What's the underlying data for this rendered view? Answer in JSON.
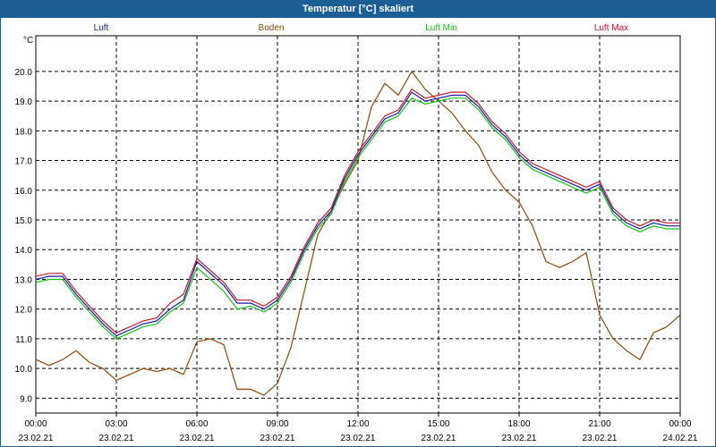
{
  "window": {
    "title": "Temperatur [°C] skaliert"
  },
  "chart_data": {
    "type": "line",
    "ylabel": "°C",
    "ylim": [
      8.5,
      21.2
    ],
    "xlim": [
      0,
      24
    ],
    "grid": true,
    "legend_placement": "top",
    "y_ticks": [
      "9.0",
      "10.0",
      "11.0",
      "12.0",
      "13.0",
      "14.0",
      "15.0",
      "16.0",
      "17.0",
      "18.0",
      "19.0",
      "20.0"
    ],
    "x_ticks": [
      {
        "time": "00:00",
        "date": "23.02.21"
      },
      {
        "time": "03:00",
        "date": "23.02.21"
      },
      {
        "time": "06:00",
        "date": "23.02.21"
      },
      {
        "time": "09:00",
        "date": "23.02.21"
      },
      {
        "time": "12:00",
        "date": "23.02.21"
      },
      {
        "time": "15:00",
        "date": "23.02.21"
      },
      {
        "time": "18:00",
        "date": "23.02.21"
      },
      {
        "time": "21:00",
        "date": "23.02.21"
      },
      {
        "time": "00:00",
        "date": "24.02.21"
      }
    ],
    "series": [
      {
        "name": "Luft",
        "color": "#1a1aa8",
        "x": [
          0,
          0.5,
          1,
          1.5,
          2,
          2.5,
          3,
          3.5,
          4,
          4.5,
          5,
          5.5,
          6,
          6.5,
          7,
          7.5,
          8,
          8.5,
          9,
          9.5,
          10,
          10.5,
          11,
          11.5,
          12,
          12.5,
          13,
          13.5,
          14,
          14.5,
          15,
          15.5,
          16,
          16.5,
          17,
          17.5,
          18,
          18.5,
          19,
          19.5,
          20,
          20.5,
          21,
          21.5,
          22,
          22.5,
          23,
          23.5,
          24
        ],
        "y": [
          13.0,
          13.1,
          13.1,
          12.5,
          12.0,
          11.5,
          11.1,
          11.3,
          11.5,
          11.6,
          12.0,
          12.3,
          13.6,
          13.2,
          12.8,
          12.2,
          12.2,
          12.0,
          12.3,
          13.0,
          14.0,
          14.8,
          15.3,
          16.4,
          17.2,
          17.8,
          18.4,
          18.6,
          19.3,
          19.0,
          19.1,
          19.2,
          19.2,
          18.8,
          18.2,
          17.8,
          17.2,
          16.8,
          16.6,
          16.4,
          16.2,
          16.0,
          16.2,
          15.3,
          14.9,
          14.7,
          14.9,
          14.8,
          14.8
        ]
      },
      {
        "name": "Boden",
        "color": "#8b4a0a",
        "x": [
          0,
          0.5,
          1,
          1.5,
          2,
          2.5,
          3,
          3.5,
          4,
          4.5,
          5,
          5.5,
          6,
          6.5,
          7,
          7.5,
          8,
          8.5,
          9,
          9.5,
          10,
          10.5,
          11,
          11.5,
          12,
          12.5,
          13,
          13.5,
          14,
          14.5,
          15,
          15.5,
          16,
          16.5,
          17,
          17.5,
          18,
          18.5,
          19,
          19.5,
          20,
          20.5,
          21,
          21.5,
          22,
          22.5,
          23,
          23.5,
          24
        ],
        "y": [
          10.3,
          10.1,
          10.3,
          10.6,
          10.2,
          10.0,
          9.6,
          9.8,
          10.0,
          9.9,
          10.0,
          9.8,
          10.9,
          11.0,
          10.8,
          9.3,
          9.3,
          9.1,
          9.5,
          10.7,
          12.6,
          14.5,
          15.3,
          16.2,
          17.0,
          18.8,
          19.6,
          19.2,
          20.0,
          19.4,
          19.0,
          18.6,
          18.0,
          17.5,
          16.6,
          16.0,
          15.6,
          14.8,
          13.6,
          13.4,
          13.6,
          13.9,
          11.8,
          11.0,
          10.6,
          10.3,
          11.2,
          11.4,
          11.8
        ]
      },
      {
        "name": "Luft Min",
        "color": "#11c411",
        "x": [
          0,
          0.5,
          1,
          1.5,
          2,
          2.5,
          3,
          3.5,
          4,
          4.5,
          5,
          5.5,
          6,
          6.5,
          7,
          7.5,
          8,
          8.5,
          9,
          9.5,
          10,
          10.5,
          11,
          11.5,
          12,
          12.5,
          13,
          13.5,
          14,
          14.5,
          15,
          15.5,
          16,
          16.5,
          17,
          17.5,
          18,
          18.5,
          19,
          19.5,
          20,
          20.5,
          21,
          21.5,
          22,
          22.5,
          23,
          23.5,
          24
        ],
        "y": [
          12.9,
          13.0,
          13.0,
          12.4,
          11.9,
          11.4,
          11.0,
          11.2,
          11.4,
          11.5,
          11.9,
          12.2,
          13.4,
          13.0,
          12.6,
          12.0,
          12.1,
          11.9,
          12.2,
          12.9,
          13.9,
          14.7,
          15.2,
          16.3,
          17.1,
          17.7,
          18.3,
          18.5,
          19.1,
          18.9,
          19.0,
          19.1,
          19.1,
          18.7,
          18.1,
          17.7,
          17.1,
          16.7,
          16.5,
          16.3,
          16.1,
          15.9,
          16.1,
          15.2,
          14.8,
          14.6,
          14.8,
          14.7,
          14.7
        ]
      },
      {
        "name": "Luft Max",
        "color": "#c21a2e",
        "x": [
          0,
          0.5,
          1,
          1.5,
          2,
          2.5,
          3,
          3.5,
          4,
          4.5,
          5,
          5.5,
          6,
          6.5,
          7,
          7.5,
          8,
          8.5,
          9,
          9.5,
          10,
          10.5,
          11,
          11.5,
          12,
          12.5,
          13,
          13.5,
          14,
          14.5,
          15,
          15.5,
          16,
          16.5,
          17,
          17.5,
          18,
          18.5,
          19,
          19.5,
          20,
          20.5,
          21,
          21.5,
          22,
          22.5,
          23,
          23.5,
          24
        ],
        "y": [
          13.1,
          13.2,
          13.2,
          12.6,
          12.1,
          11.6,
          11.2,
          11.4,
          11.6,
          11.7,
          12.2,
          12.5,
          13.7,
          13.3,
          12.9,
          12.3,
          12.3,
          12.1,
          12.4,
          13.1,
          14.1,
          14.9,
          15.4,
          16.5,
          17.3,
          17.9,
          18.5,
          18.7,
          19.4,
          19.1,
          19.2,
          19.3,
          19.3,
          18.9,
          18.3,
          17.9,
          17.3,
          16.9,
          16.7,
          16.5,
          16.3,
          16.1,
          16.3,
          15.4,
          15.0,
          14.8,
          15.0,
          14.9,
          14.9
        ]
      }
    ]
  }
}
